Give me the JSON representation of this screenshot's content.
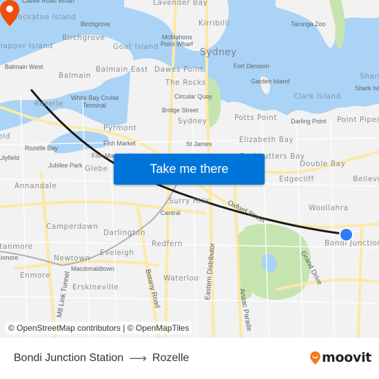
{
  "map": {
    "labels": {
      "clarke_road_wharf": "Clarke Road Wharf",
      "lavender_bay": "Lavender Bay",
      "cockatoo_island": "Cockatoo Island",
      "birchgrove_small": "Birchgrove",
      "birchgrove": "Birchgrove",
      "kirribilli": "Kirribilli",
      "taronga_zoo": "Taronga Zoo",
      "mcmahons_point_wharf_1": "McMahons",
      "mcmahons_point_wharf_2": "Point Wharf",
      "snapper_island": "Snapper Island",
      "goat_island": "Goat Island",
      "sydney_city": "Sydney",
      "balmain_west": "Balmain West",
      "balmain": "Balmain",
      "balmain_east": "Balmain East",
      "dawes_point": "Dawes Point",
      "fort_denison": "Fort Denison",
      "shark_point": "Shark",
      "shark_island": "Shark Isl",
      "garden_island": "Garden Island",
      "the_rocks": "The Rocks",
      "circular_quay": "Circular Quay",
      "clark_island": "Clark Island",
      "rozelle": "Rozelle",
      "white_bay_1": "White Bay Cruise",
      "white_bay_2": "Terminal",
      "bridge_street": "Bridge Street",
      "sydney_suburb": "Sydney",
      "potts_point": "Potts Point",
      "darling_point": "Darling Point",
      "point_piper": "Point Piper",
      "pyrmont": "Pyrmont",
      "lilyfield_partial": "eld",
      "fish_market": "Fish Market",
      "st_james": "St James",
      "elizabeth_bay": "Elizabeth Bay",
      "rozelle_bay": "Rozelle Bay",
      "lilyfield": "Lilyfield",
      "fish_market_wharf": "Fish Market Wharf",
      "rushcutters_bay": "Rushcutters Bay",
      "jubilee_park": "Jubilee Park",
      "glebe": "Glebe",
      "double_bay": "Double Bay",
      "edgecliff": "Edgecliff",
      "bellevue": "Bellevu",
      "annandale": "Annandale",
      "surry_hills": "Surry Hills",
      "oxford_street": "Oxford Street",
      "central": "Central",
      "woollahra": "Woollahra",
      "camperdown": "Camperdown",
      "darlington": "Darlington",
      "bondi_junction": "Bondi Junction",
      "redfern": "Redfern",
      "stanmore": "Stanmore",
      "enmore_station": "Enmore",
      "newtown": "Newtown",
      "eveleigh": "Eveleigh",
      "grand_drive": "Grand Drive",
      "macdonaldtown": "Macdonaldtown",
      "enmore": "Enmore",
      "waterloo": "Waterloo",
      "erskineville": "Erskineville",
      "m8_link_tunnel": "M8 Link Tunnel",
      "botany_road": "Botany Road",
      "eastern_distributor": "Eastern Distributor",
      "anzac_parade": "Anzac Parade"
    },
    "origin": "Bondi Junction Station",
    "destination": "Rozelle",
    "cta_label": "Take me there",
    "attribution": "© OpenStreetMap contributors | © OpenMapTiles",
    "colors": {
      "water": "#aad3f5",
      "land": "#f2f2f2",
      "park": "#c6e4b0",
      "road": "#fbe9a6",
      "route": "#1a1a1a",
      "origin": "#2f7cf6",
      "destination": "#f04e0a",
      "cta": "#0075d9"
    }
  },
  "footer": {
    "origin": "Bondi Junction Station",
    "arrow": "⟶",
    "destination": "Rozelle",
    "brand": "moovit",
    "brand_color": "#f47920"
  }
}
